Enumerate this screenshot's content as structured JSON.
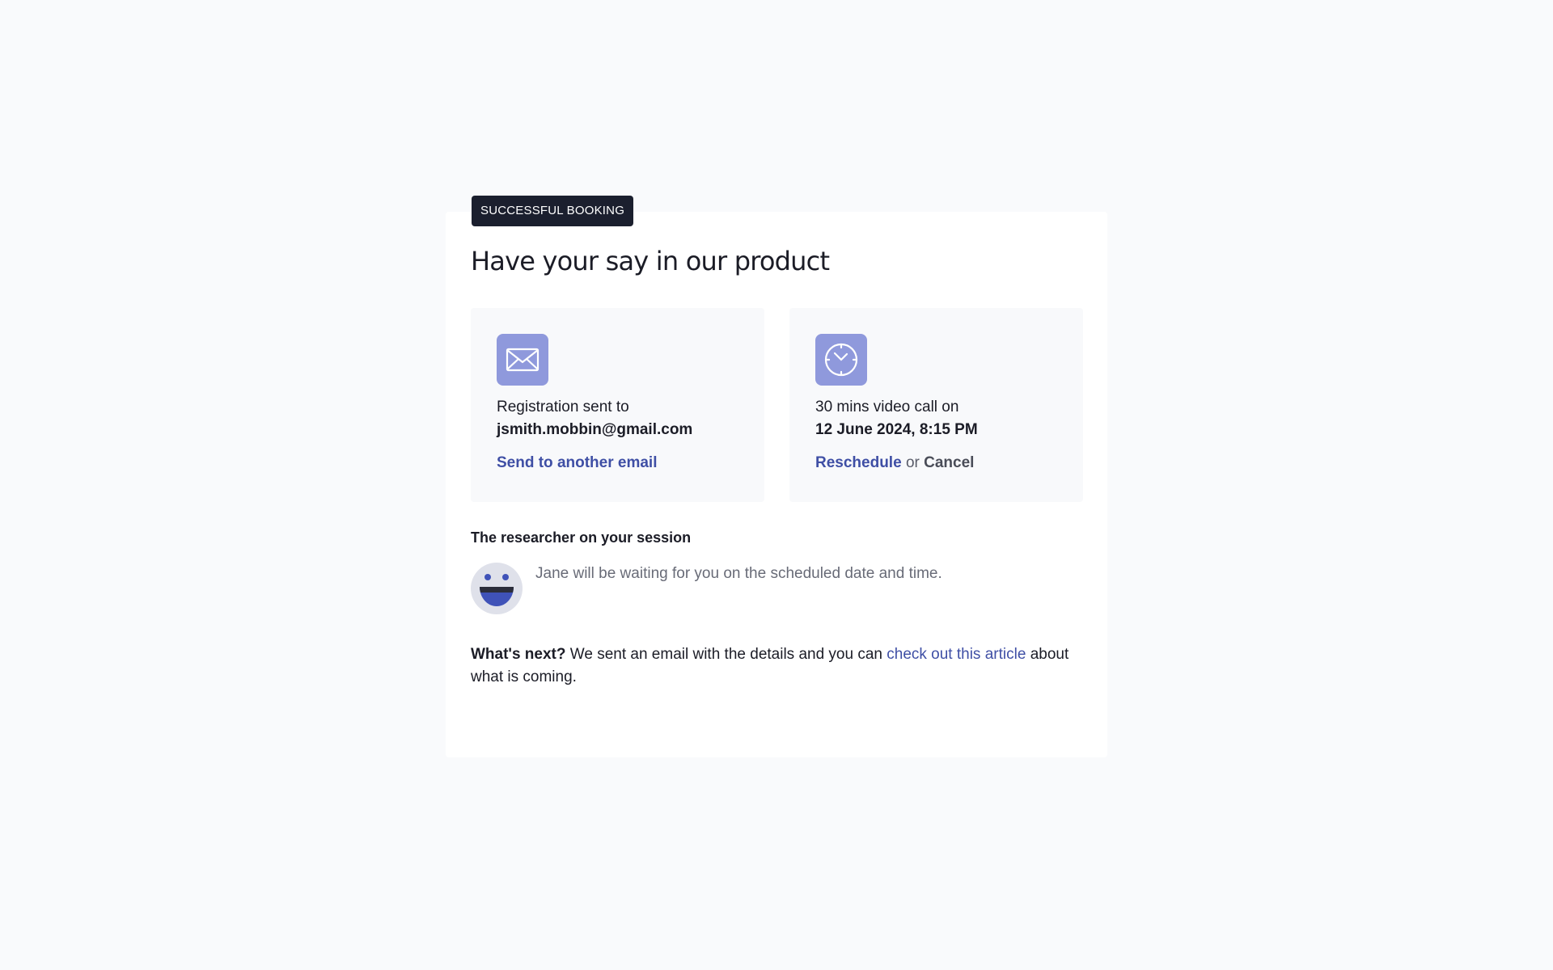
{
  "badge": {
    "label": "SUCCESSFUL BOOKING"
  },
  "title": "Have your say in our product",
  "registration": {
    "icon": "envelope-icon",
    "line1": "Registration sent to",
    "email": "jsmith.mobbin@gmail.com",
    "action_label": "Send to another email"
  },
  "schedule": {
    "icon": "clock-icon",
    "line1": "30 mins video call on",
    "datetime": "12 June 2024, 8:15 PM",
    "reschedule_label": "Reschedule",
    "separator": "or",
    "cancel_label": "Cancel"
  },
  "researcher": {
    "heading": "The researcher on your session",
    "avatar_icon": "smiley-avatar-icon",
    "message": "Jane will be waiting for you on the scheduled date and time."
  },
  "next": {
    "lead": "What's next?",
    "text_before": "We sent an email with the details and you can",
    "link_label": "check out this article",
    "text_after": "about what is coming."
  },
  "colors": {
    "background": "#f9fafc",
    "card": "#ffffff",
    "badge": "#1b1f2e",
    "accent_link": "#3f4fa5",
    "icon_tile": "#8f99dc",
    "info_box": "#f8f9fb"
  }
}
